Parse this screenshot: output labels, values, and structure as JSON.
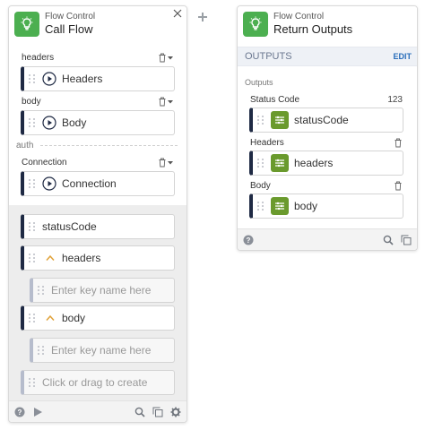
{
  "canvas": {
    "add_icon": "plus-icon"
  },
  "call_flow": {
    "subtitle": "Flow Control",
    "title": "Call Flow",
    "sections": {
      "headers_label": "headers",
      "headers_value": "Headers",
      "body_label": "body",
      "body_value": "Body",
      "auth_label": "auth",
      "connection_label": "Connection",
      "connection_value": "Connection"
    },
    "outputs": {
      "status_code": "statusCode",
      "headers": "headers",
      "headers_placeholder": "Enter key name here",
      "body": "body",
      "body_placeholder": "Enter key name here",
      "create_placeholder": "Click or drag to create"
    }
  },
  "return_outputs": {
    "subtitle": "Flow Control",
    "title": "Return Outputs",
    "bar_label": "OUTPUTS",
    "edit_label": "EDIT",
    "outputs_label": "Outputs",
    "fields": [
      {
        "label": "Status Code",
        "badge": "123",
        "value": "statusCode"
      },
      {
        "label": "Headers",
        "value": "headers"
      },
      {
        "label": "Body",
        "value": "body"
      }
    ]
  },
  "colors": {
    "accent_green": "#4caf50",
    "mapping_green": "#6a9a2d",
    "pill_border_dark": "#1f2a44",
    "link_blue": "#2a6ebb"
  }
}
